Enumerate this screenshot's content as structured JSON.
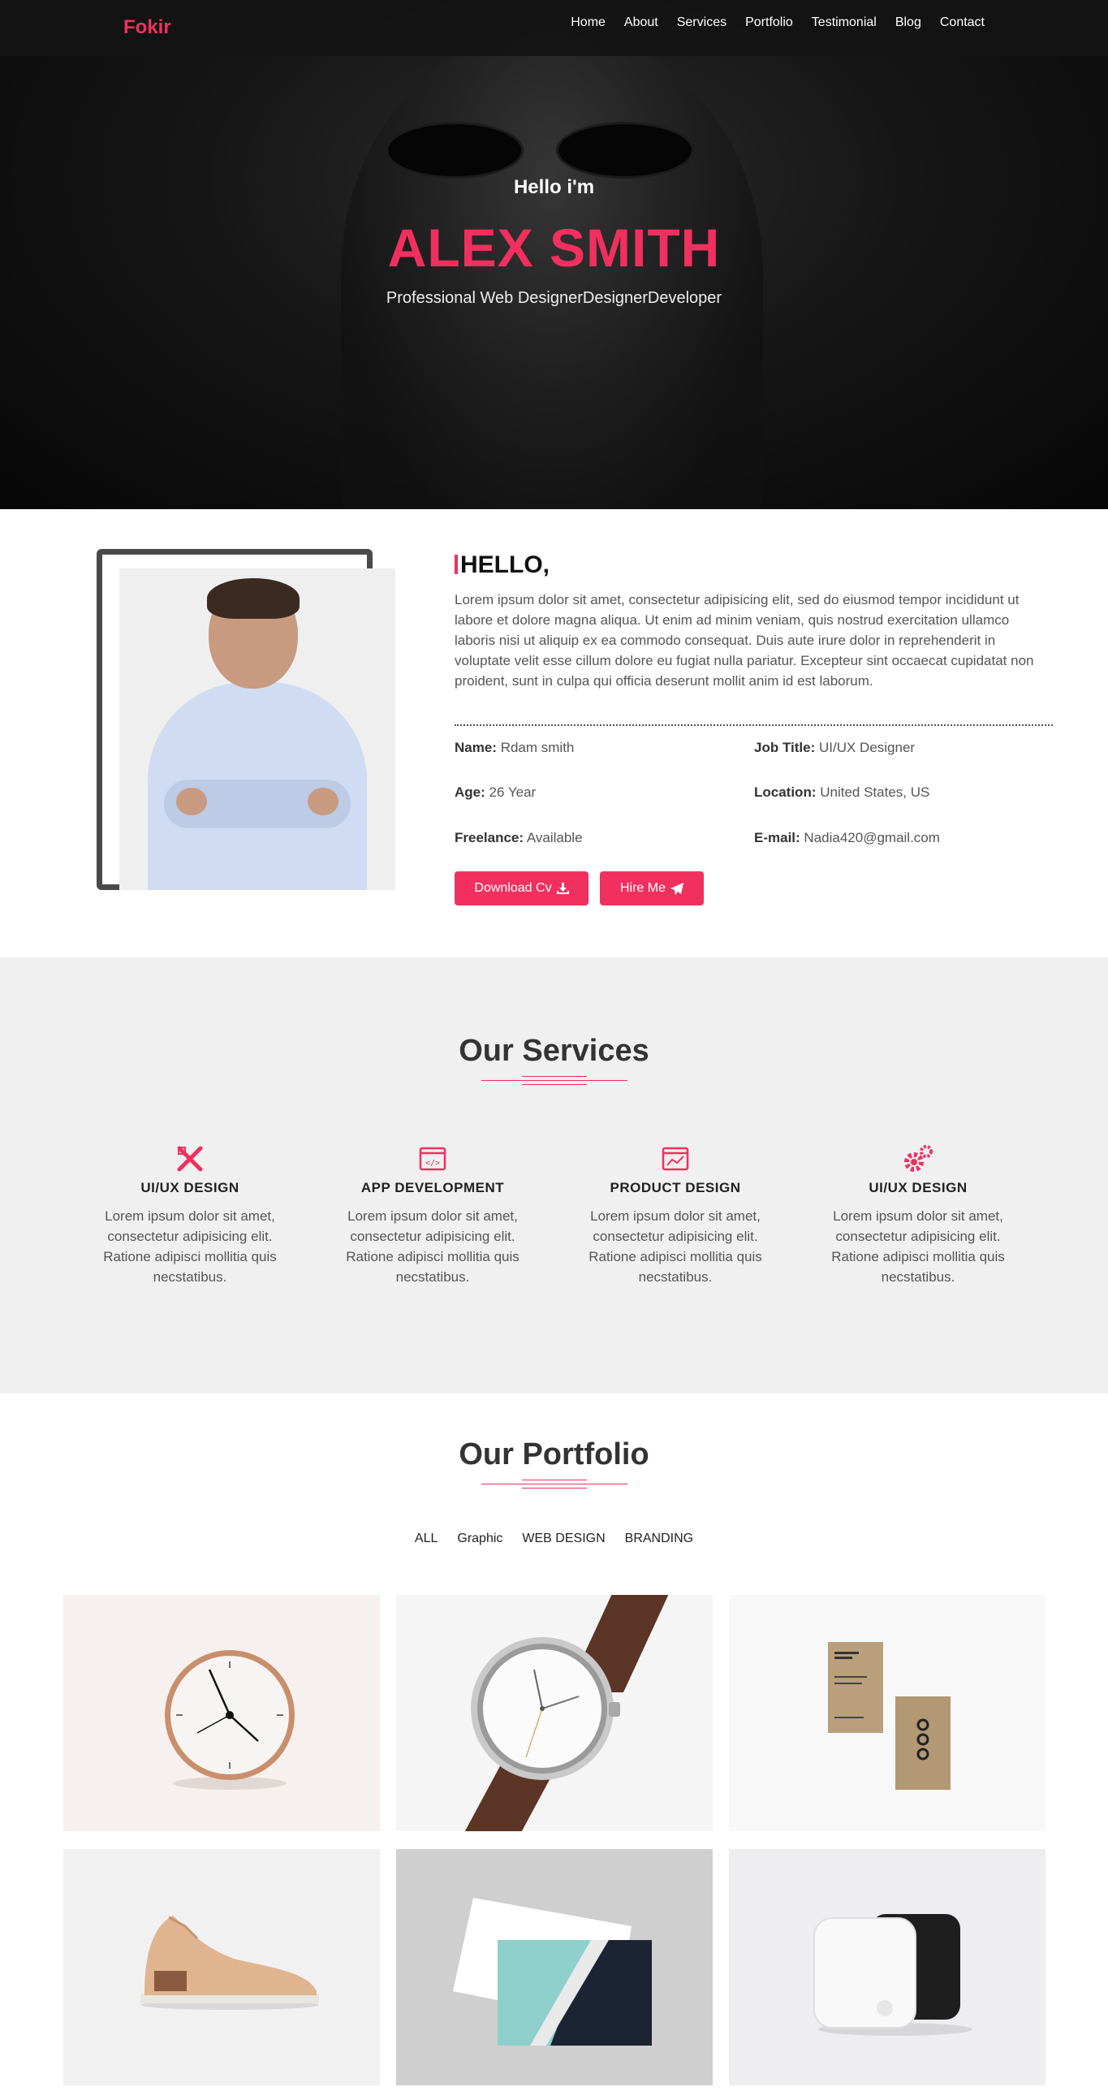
{
  "nav": {
    "brand": "Fokir",
    "items": [
      "Home",
      "About",
      "Services",
      "Portfolio",
      "Testimonial",
      "Blog",
      "Contact"
    ]
  },
  "hero": {
    "greeting": "Hello i'm",
    "name": "ALEX SMITH",
    "subtitle": "Professional Web DesignerDesignerDeveloper"
  },
  "about": {
    "heading": "HELLO,",
    "description": "Lorem ipsum dolor sit amet, consectetur adipisicing elit, sed do eiusmod tempor incididunt ut labore et dolore magna aliqua. Ut enim ad minim veniam, quis nostrud exercitation ullamco laboris nisi ut aliquip ex ea commodo consequat. Duis aute irure dolor in reprehenderit in voluptate velit esse cillum dolore eu fugiat nulla pariatur. Excepteur sint occaecat cupidatat non proident, sunt in culpa qui officia deserunt mollit anim id est laborum.",
    "info": [
      {
        "label": "Name:",
        "value": "Rdam smith"
      },
      {
        "label": "Job Title:",
        "value": "UI/UX Designer"
      },
      {
        "label": "Age:",
        "value": "26 Year"
      },
      {
        "label": "Location:",
        "value": "United States, US"
      },
      {
        "label": "Freelance:",
        "value": "Available"
      },
      {
        "label": "E-mail:",
        "value": "Nadia420@gmail.com"
      }
    ],
    "download_label": "Download Cv",
    "hire_label": "Hire Me"
  },
  "services": {
    "title": "Our Services",
    "items": [
      {
        "title": "UI/UX DESIGN",
        "icon": "design-tools-icon",
        "desc": "Lorem ipsum dolor sit amet, consectetur adipisicing elit. Ratione adipisci mollitia quis necstatibus."
      },
      {
        "title": "APP DEVELOPMENT",
        "icon": "code-window-icon",
        "desc": "Lorem ipsum dolor sit amet, consectetur adipisicing elit. Ratione adipisci mollitia quis necstatibus."
      },
      {
        "title": "PRODUCT DESIGN",
        "icon": "chart-window-icon",
        "desc": "Lorem ipsum dolor sit amet, consectetur adipisicing elit. Ratione adipisci mollitia quis necstatibus."
      },
      {
        "title": "UI/UX DESIGN",
        "icon": "gears-icon",
        "desc": "Lorem ipsum dolor sit amet, consectetur adipisicing elit. Ratione adipisci mollitia quis necstatibus."
      }
    ]
  },
  "portfolio": {
    "title": "Our Portfolio",
    "filters": [
      "ALL",
      "Graphic",
      "WEB DESIGN",
      "BRANDING"
    ]
  },
  "colors": {
    "accent": "#f1305f",
    "nav_bg": "#141414",
    "services_bg": "#f0f0f0"
  }
}
